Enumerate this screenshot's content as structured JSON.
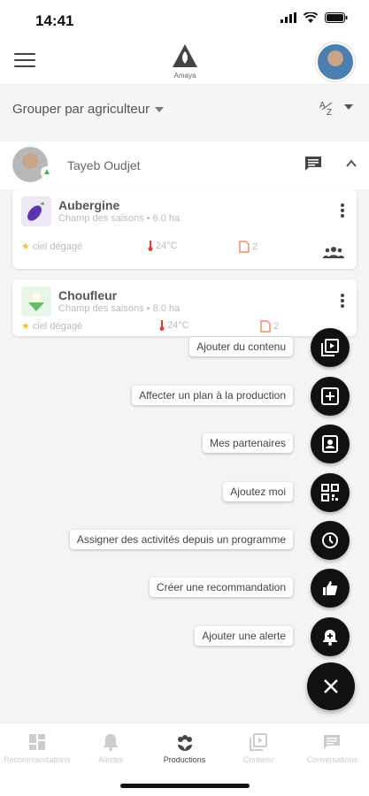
{
  "status": {
    "time": "14:41"
  },
  "header": {
    "logo_text": "Amaya"
  },
  "group_bar": {
    "label": "Grouper par agriculteur",
    "sort_label": "A-Z"
  },
  "farmer": {
    "name": "Tayeb  Oudjet"
  },
  "productions": [
    {
      "title": "Aubergine",
      "subtitle": "Champ des saisons • 6.0 ha",
      "weather": "ciel dégagé",
      "temperature": "24°C",
      "documents": "2"
    },
    {
      "title": "Choufleur",
      "subtitle": "Champ des saisons • 8.0 ha",
      "weather": "ciel dégagé",
      "temperature": "24°C",
      "documents": "2"
    }
  ],
  "actions": [
    {
      "label": "Ajouter du contenu",
      "icon": "video-library-icon"
    },
    {
      "label": "Affecter un plan à la production",
      "icon": "add-box-icon"
    },
    {
      "label": "Mes partenaires",
      "icon": "contact-card-icon"
    },
    {
      "label": "Ajoutez moi",
      "icon": "qr-code-icon"
    },
    {
      "label": "Assigner des activités depuis un programme",
      "icon": "clock-icon"
    },
    {
      "label": "Créer une recommandation",
      "icon": "thumb-up-icon"
    },
    {
      "label": "Ajouter une alerte",
      "icon": "bell-plus-icon"
    }
  ],
  "bottom_nav": [
    {
      "label": "Recommandations",
      "icon": "dashboard-icon"
    },
    {
      "label": "Alertes",
      "icon": "bell-icon"
    },
    {
      "label": "Productions",
      "icon": "plant-icon",
      "active": true
    },
    {
      "label": "Contenu",
      "icon": "video-library-icon"
    },
    {
      "label": "Conversations",
      "icon": "chat-icon"
    }
  ],
  "colors": {
    "fab": "#111111",
    "accent_green": "#4caf50",
    "temp_red": "#e53935",
    "doc_orange": "#ff8a65",
    "star_yellow": "#fbc02d"
  }
}
